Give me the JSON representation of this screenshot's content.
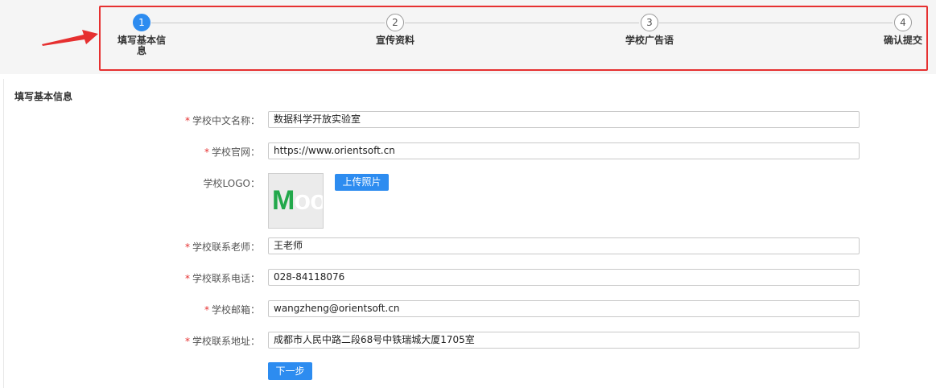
{
  "steps": [
    {
      "number": "1",
      "label_line1": "填写基本信",
      "label_line2": "息",
      "state": "active"
    },
    {
      "number": "2",
      "label": "宣传资料",
      "state": "idle"
    },
    {
      "number": "3",
      "label": "学校广告语",
      "state": "idle"
    },
    {
      "number": "4",
      "label": "确认提交",
      "state": "idle"
    }
  ],
  "section_title": "填写基本信息",
  "form": {
    "cn_name": {
      "required": "*",
      "label": "学校中文名称：",
      "value": "数据科学开放实验室"
    },
    "website": {
      "required": "*",
      "label": "学校官网：",
      "value": "https://www.orientsoft.cn"
    },
    "logo": {
      "label": "学校LOGO：",
      "logo_text_main": "M",
      "logo_text_faded": "oo",
      "upload_label": "上传照片"
    },
    "teacher": {
      "required": "*",
      "label": "学校联系老师：",
      "value": "王老师"
    },
    "phone": {
      "required": "*",
      "label": "学校联系电话：",
      "value": "028-84118076"
    },
    "email": {
      "required": "*",
      "label": "学校邮箱：",
      "value": "wangzheng@orientsoft.cn"
    },
    "address": {
      "required": "*",
      "label": "学校联系地址：",
      "value": "成都市人民中路二段68号中铁瑞城大厦1705室"
    }
  },
  "next_button": "下一步",
  "colors": {
    "primary": "#2d8cf0",
    "highlight_border": "#e63030",
    "required": "#e63030",
    "logo_green": "#22a84b"
  }
}
